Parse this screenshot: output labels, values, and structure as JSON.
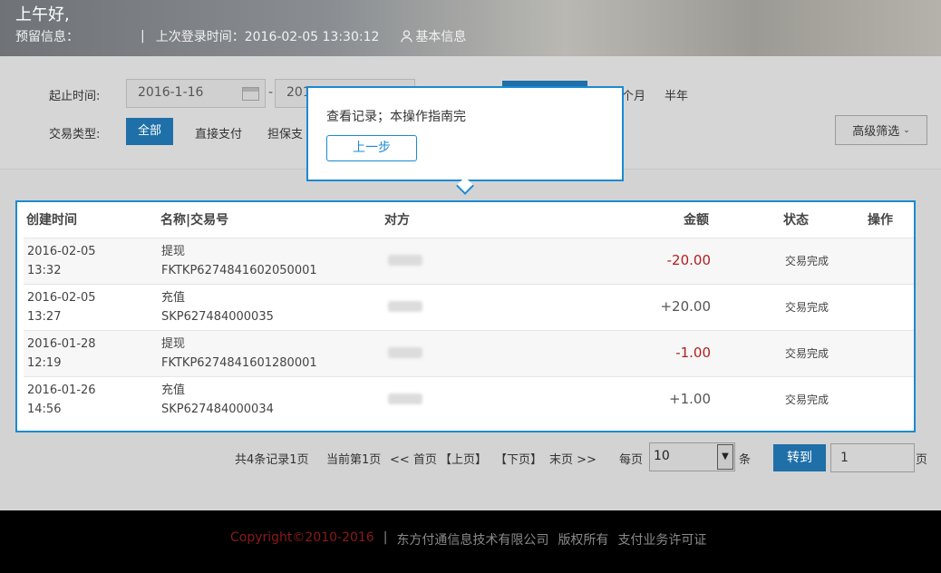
{
  "header": {
    "greeting": "上午好,",
    "reserved_info_label": "预留信息：",
    "separator": "|",
    "last_login": "上次登录时间：2016-02-05 13:30:12",
    "basic_info": "基本信息"
  },
  "filters": {
    "date_label": "起止时间:",
    "start_date": "2016-1-16",
    "end_date_partial": "201",
    "dash": "-",
    "range_month_partial": "个月",
    "range_half_year": "半年",
    "type_label": "交易类型:",
    "type_all": "全部",
    "type_direct": "直接支付",
    "type_escrow_partial": "担保支",
    "advanced": "高级筛选"
  },
  "tooltip": {
    "text": "查看记录；本操作指南完",
    "prev_button": "上一步"
  },
  "table": {
    "headers": [
      "创建时间",
      "名称|交易号",
      "对方",
      "金额",
      "状态",
      "操作"
    ],
    "rows": [
      {
        "date": "2016-02-05",
        "time": "13:32",
        "name": "提现",
        "tx": "FKTKP6274841602050001",
        "amount": "-20.00",
        "status": "交易完成"
      },
      {
        "date": "2016-02-05",
        "time": "13:27",
        "name": "充值",
        "tx": "SKP627484000035",
        "amount": "+20.00",
        "status": "交易完成"
      },
      {
        "date": "2016-01-28",
        "time": "12:19",
        "name": "提现",
        "tx": "FKTKP6274841601280001",
        "amount": "-1.00",
        "status": "交易完成"
      },
      {
        "date": "2016-01-26",
        "time": "14:56",
        "name": "充值",
        "tx": "SKP627484000034",
        "amount": "+1.00",
        "status": "交易完成"
      }
    ]
  },
  "pager": {
    "summary": "共4条记录1页",
    "current": "当前第1页",
    "first": "<< 首页",
    "prev": "【上页】",
    "next": "【下页】",
    "last": "末页 >>",
    "per_page_label": "每页",
    "per_page_value": "10",
    "per_page_unit": "条",
    "goto_button": "转到",
    "page_value": "1",
    "page_unit": "页"
  },
  "footer": {
    "copyright": "Copyright©2010-2016",
    "sep": "|",
    "company": "东方付通信息技术有限公司",
    "rights": "版权所有",
    "license": "支付业务许可证"
  },
  "colors": {
    "accent": "#1a8ad2",
    "primary_button": "#1f6fa8",
    "negative_amount": "#b41d1d",
    "footer_copyright": "#8b1a1a"
  }
}
